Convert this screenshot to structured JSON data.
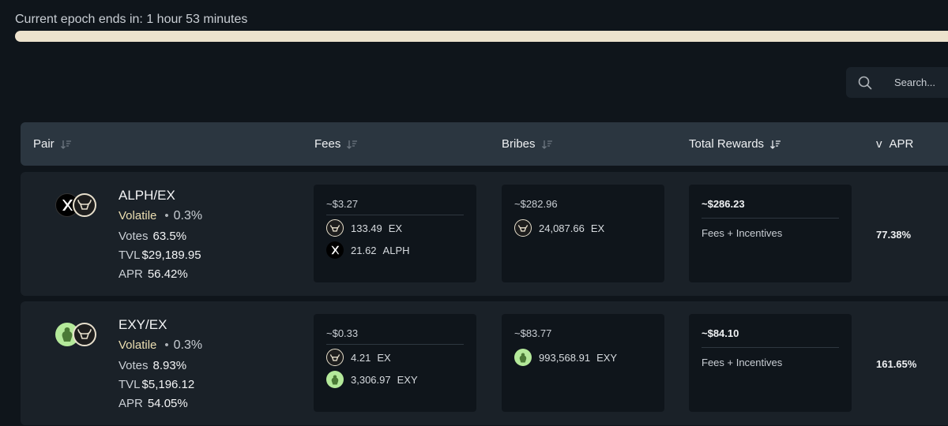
{
  "epoch": {
    "label": "Current epoch ends in: 1 hour 53 minutes",
    "progress": 1.0
  },
  "search": {
    "placeholder": "Search..."
  },
  "table": {
    "headers": {
      "pair": "Pair",
      "fees": "Fees",
      "bribes": "Bribes",
      "total_rewards": "Total Rewards",
      "apr": "APR",
      "apr_prefix": "v"
    },
    "rows": [
      {
        "pair": "ALPH/EX",
        "type": "Volatile",
        "fee_tier": "0.3%",
        "votes_label": "Votes",
        "votes": "63.5%",
        "tvl_label": "TVL",
        "tvl": "$29,189.95",
        "apr_label": "APR",
        "apr": "56.42%",
        "fees": {
          "total": "~$3.27",
          "tokens": [
            {
              "amount": "133.49",
              "symbol": "EX",
              "icon": "ex-token-icon"
            },
            {
              "amount": "21.62",
              "symbol": "ALPH",
              "icon": "alph-token-icon"
            }
          ]
        },
        "bribes": {
          "total": "~$282.96",
          "tokens": [
            {
              "amount": "24,087.66",
              "symbol": "EX",
              "icon": "ex-token-icon"
            }
          ]
        },
        "total_rewards": {
          "total": "~$286.23",
          "label": "Fees + Incentives"
        },
        "reward_apr": "77.38%"
      },
      {
        "pair": "EXY/EX",
        "type": "Volatile",
        "fee_tier": "0.3%",
        "votes_label": "Votes",
        "votes": "8.93%",
        "tvl_label": "TVL",
        "tvl": "$5,196.12",
        "apr_label": "APR",
        "apr": "54.05%",
        "fees": {
          "total": "~$0.33",
          "tokens": [
            {
              "amount": "4.21",
              "symbol": "EX",
              "icon": "ex-token-icon"
            },
            {
              "amount": "3,306.97",
              "symbol": "EXY",
              "icon": "exy-token-icon"
            }
          ]
        },
        "bribes": {
          "total": "~$83.77",
          "tokens": [
            {
              "amount": "993,568.91",
              "symbol": "EXY",
              "icon": "exy-token-icon"
            }
          ]
        },
        "total_rewards": {
          "total": "~$84.10",
          "label": "Fees + Incentives"
        },
        "reward_apr": "161.65%"
      }
    ]
  },
  "colors": {
    "background": "#0f151b",
    "row": "#1a2128",
    "header": "#2b3640",
    "progress": "#ece2cd",
    "volatile": "#ecdfb2",
    "exy_green": "#b4e99a"
  }
}
